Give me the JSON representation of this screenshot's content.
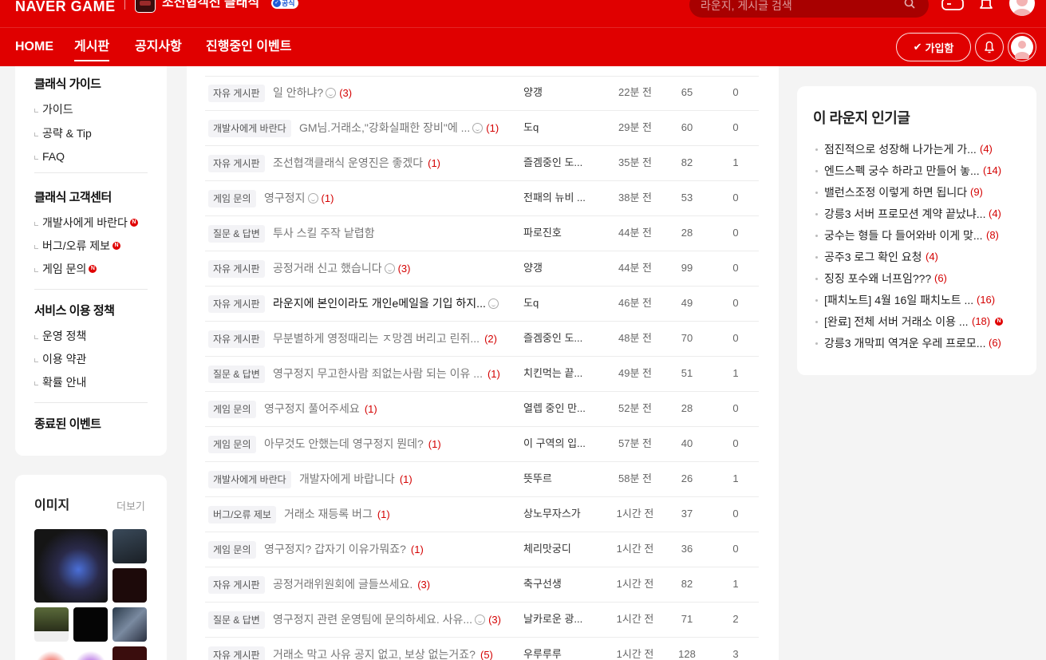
{
  "header": {
    "logo": "NAVER GAME",
    "lounge_name": "조선협객전 클래식",
    "official_label": "공식",
    "search_placeholder": "라운지, 게시글 검색"
  },
  "nav": {
    "items": [
      "HOME",
      "게시판",
      "공지사항",
      "진행중인 이벤트"
    ],
    "active": "게시판",
    "join_label": "가입함"
  },
  "sidebar": {
    "sections": [
      {
        "title": "클래식 가이드",
        "links": [
          {
            "label": "가이드",
            "new": false
          },
          {
            "label": "공략 & Tip",
            "new": false
          },
          {
            "label": "FAQ",
            "new": false
          }
        ]
      },
      {
        "title": "클래식 고객센터",
        "links": [
          {
            "label": "개발사에게 바란다",
            "new": true
          },
          {
            "label": "버그/오류 제보",
            "new": true
          },
          {
            "label": "게임 문의",
            "new": true
          }
        ]
      },
      {
        "title": "서비스 이용 정책",
        "links": [
          {
            "label": "운영 정책",
            "new": false
          },
          {
            "label": "이용 약관",
            "new": false
          },
          {
            "label": "확률 안내",
            "new": false
          }
        ]
      },
      {
        "title": "종료된 이벤트",
        "links": []
      }
    ],
    "new_badge": "N"
  },
  "images": {
    "title": "이미지",
    "more": "더보기"
  },
  "posts": [
    {
      "category": "자유 게시판",
      "title": "일 안하냐?",
      "icon": true,
      "comments": "(3)",
      "author": "양갱",
      "time": "22분 전",
      "views": "65",
      "likes": "0",
      "read": true
    },
    {
      "category": "개발사에게 바란다",
      "title": "GM님.거래소,\"강화실패한 장비\"에 ...",
      "icon": true,
      "comments": "(1)",
      "author": "도q",
      "time": "29분 전",
      "views": "60",
      "likes": "0",
      "read": true
    },
    {
      "category": "자유 게시판",
      "title": "조선협객클래식 운영진은 좋겠다",
      "icon": false,
      "comments": "(1)",
      "author": "즐겜중인 도...",
      "time": "35분 전",
      "views": "82",
      "likes": "1",
      "read": true
    },
    {
      "category": "게임 문의",
      "title": "영구정지",
      "icon": true,
      "comments": "(1)",
      "author": "전패의 뉴비 ...",
      "time": "38분 전",
      "views": "53",
      "likes": "0",
      "read": true
    },
    {
      "category": "질문 & 답변",
      "title": "투사 스킬 주작 낱렵함",
      "icon": false,
      "comments": "",
      "author": "파로진호",
      "time": "44분 전",
      "views": "28",
      "likes": "0",
      "read": true
    },
    {
      "category": "자유 게시판",
      "title": "공정거래 신고 했습니다",
      "icon": true,
      "comments": "(3)",
      "author": "양갱",
      "time": "44분 전",
      "views": "99",
      "likes": "0",
      "read": true
    },
    {
      "category": "자유 게시판",
      "title": "라운지에 본인이라도 개인e메일을 기입 하지...",
      "icon": true,
      "comments": "",
      "author": "도q",
      "time": "46분 전",
      "views": "49",
      "likes": "0",
      "read": false
    },
    {
      "category": "자유 게시판",
      "title": "무분별하게 영정때리는 ㅈ망겜 버리고 린쥐...",
      "icon": false,
      "comments": "(2)",
      "author": "즐겜중인 도...",
      "time": "48분 전",
      "views": "70",
      "likes": "0",
      "read": true
    },
    {
      "category": "질문 & 답변",
      "title": "영구정지 무고한사람 죄없는사람 되는 이유 ...",
      "icon": false,
      "comments": "(1)",
      "author": "치킨먹는 끝...",
      "time": "49분 전",
      "views": "51",
      "likes": "1",
      "read": true
    },
    {
      "category": "게임 문의",
      "title": "영구정지 풀어주세요",
      "icon": false,
      "comments": "(1)",
      "author": "열렙 중인 만...",
      "time": "52분 전",
      "views": "28",
      "likes": "0",
      "read": true
    },
    {
      "category": "게임 문의",
      "title": "아무것도 안했는데 영구정지 뭔데?",
      "icon": false,
      "comments": "(1)",
      "author": "이 구역의 입...",
      "time": "57분 전",
      "views": "40",
      "likes": "0",
      "read": true
    },
    {
      "category": "개발사에게 바란다",
      "title": "개발자에게 바랍니다",
      "icon": false,
      "comments": "(1)",
      "author": "뜻뚜르",
      "time": "58분 전",
      "views": "26",
      "likes": "1",
      "read": true
    },
    {
      "category": "버그/오류 제보",
      "title": "거래소 재등록 버그",
      "icon": false,
      "comments": "(1)",
      "author": "상노무자스가",
      "time": "1시간 전",
      "views": "37",
      "likes": "0",
      "read": true
    },
    {
      "category": "게임 문의",
      "title": "영구정지? 갑자기 이유가뭐죠?",
      "icon": false,
      "comments": "(1)",
      "author": "체리맛궁디",
      "time": "1시간 전",
      "views": "36",
      "likes": "0",
      "read": true
    },
    {
      "category": "자유 게시판",
      "title": "공정거래위원회에 글들쓰세요.",
      "icon": false,
      "comments": "(3)",
      "author": "축구선생",
      "time": "1시간 전",
      "views": "82",
      "likes": "1",
      "read": true
    },
    {
      "category": "질문 & 답변",
      "title": "영구정지 관련 운영팀에 문의하세요. 사유...",
      "icon": true,
      "comments": "(3)",
      "author": "날카로운 광...",
      "time": "1시간 전",
      "views": "71",
      "likes": "2",
      "read": true
    },
    {
      "category": "자유 게시판",
      "title": "거래소 막고 사유 공지 없고, 보상 없는거죠?",
      "icon": false,
      "comments": "(5)",
      "author": "우루루루",
      "time": "1시간 전",
      "views": "128",
      "likes": "3",
      "read": true
    }
  ],
  "popular": {
    "title": "이 라운지 인기글",
    "items": [
      {
        "title": "점진적으로 성장해 나가는게 가...",
        "count": "(4)",
        "new": false
      },
      {
        "title": "엔드스펙 궁수 하라고 만들어 놓...",
        "count": "(14)",
        "new": false
      },
      {
        "title": "밸런스조정 이렇게 하면 됩니다",
        "count": "(9)",
        "new": false
      },
      {
        "title": "강릉3 서버 프로모션 계약 끝났냐...",
        "count": "(4)",
        "new": false
      },
      {
        "title": "궁수는 형들 다 들어와바 이게 맞...",
        "count": "(8)",
        "new": false
      },
      {
        "title": "공주3 로그 확인 요청",
        "count": "(4)",
        "new": false
      },
      {
        "title": "징징 포수왜 너프임???",
        "count": "(6)",
        "new": false
      },
      {
        "title": "[패치노트] 4월 16일 패치노트 ...",
        "count": "(16)",
        "new": false
      },
      {
        "title": "[완료] 전체 서버 거래소 이용 ...",
        "count": "(18)",
        "new": true
      },
      {
        "title": "강릉3 개막피 역겨운 우레 프로모...",
        "count": "(6)",
        "new": false
      }
    ]
  },
  "colors": {
    "brand_red": "#e00000",
    "comment_red": "#d40000"
  }
}
